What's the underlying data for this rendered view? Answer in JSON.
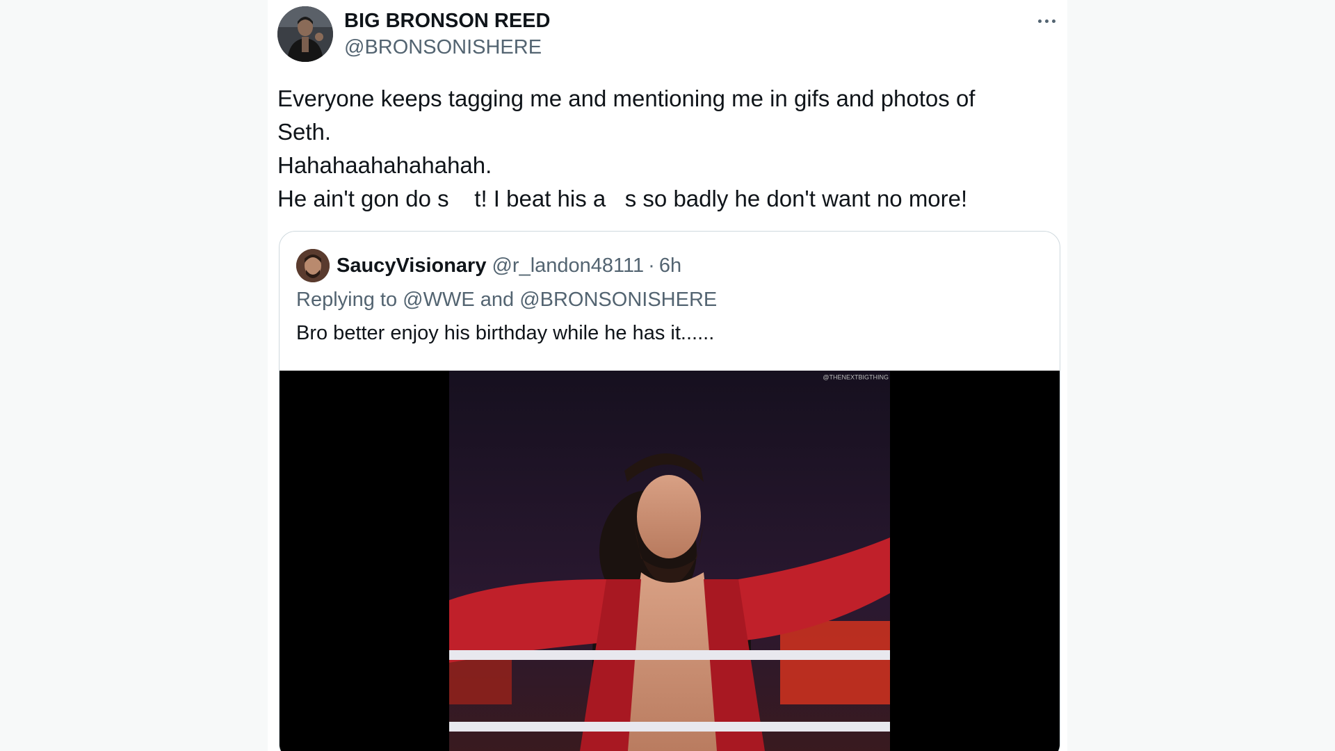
{
  "tweet": {
    "display_name": "BIG BRONSON REED",
    "handle": "@BRONSONISHERE",
    "more_icon": "more-horizontal-icon",
    "text_lines": [
      "Everyone keeps tagging me and mentioning me in gifs and photos of",
      "Seth.",
      "Hahahaahahahahah.",
      "He ain't gon do s    t! I beat his a   s so badly he don't want no more!"
    ]
  },
  "quoted_tweet": {
    "display_name": "SaucyVisionary",
    "handle": "@r_landon48111",
    "separator": "·",
    "time": "6h",
    "reply_prefix": "Replying to",
    "reply_mention_1": "@WWE",
    "reply_and": "and",
    "reply_mention_2": "@BRONSONISHERE",
    "text": "Bro better enjoy his birthday while he has it......",
    "media_watermark": "@THENEXTBIGTHING"
  },
  "colors": {
    "text": "#0f1419",
    "secondary": "#536471",
    "border": "#cfd9de",
    "jacket_red": "#c0202a"
  }
}
